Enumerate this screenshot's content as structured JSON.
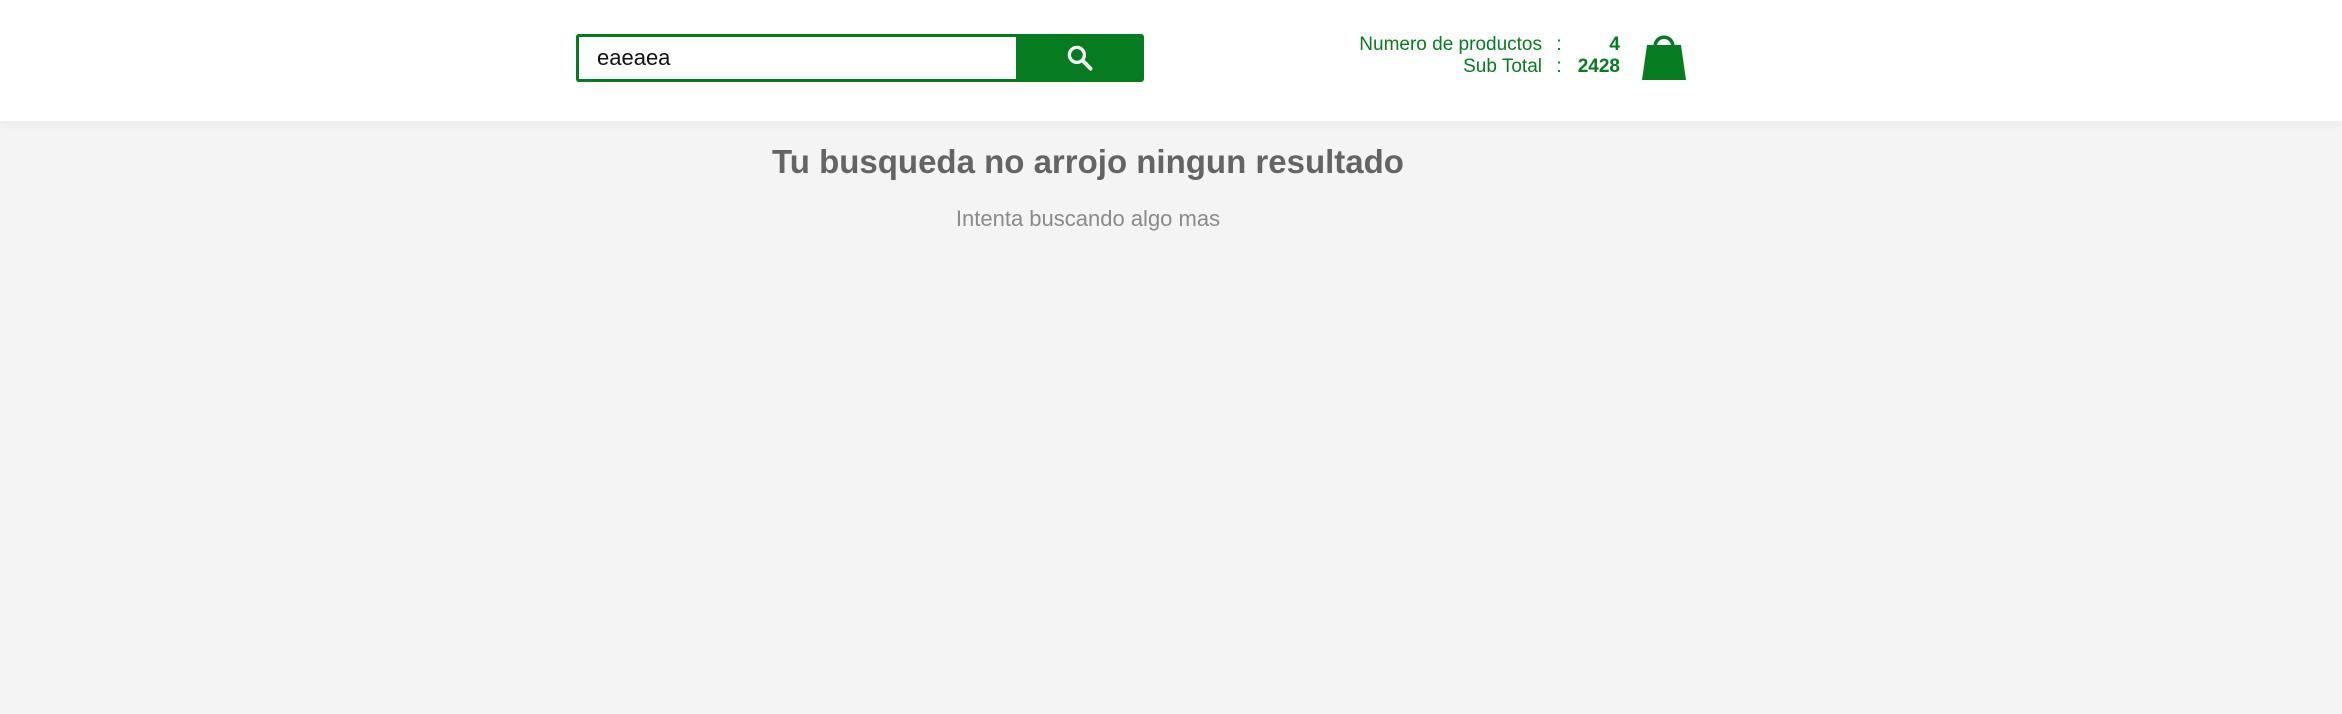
{
  "search": {
    "value": "eaeaea",
    "button_icon": "search-icon"
  },
  "cart": {
    "products_label": "Numero de productos",
    "separator": ":",
    "products_count": "4",
    "subtotal_label": "Sub Total",
    "subtotal_value": "2428",
    "icon": "shopping-bag-icon"
  },
  "results": {
    "title": "Tu busqueda no arrojo ningun resultado",
    "subtitle": "Intenta buscando algo mas"
  },
  "colors": {
    "brand_green": "#077b1f",
    "page_background": "#f4f4f4",
    "title_gray": "#646464",
    "subtitle_gray": "#8a8a8a"
  }
}
